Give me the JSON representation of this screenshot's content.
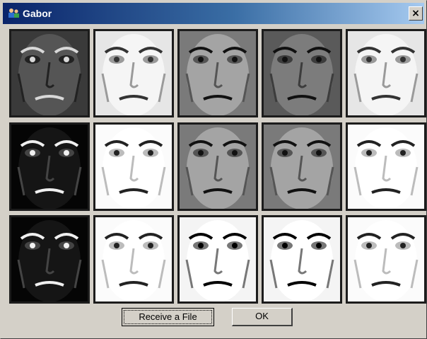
{
  "window": {
    "title": "Gabor",
    "close_glyph": "×",
    "app_icon": "people-app-icon"
  },
  "grid": {
    "rows": 3,
    "columns": 5,
    "tiles": [
      {
        "row": 1,
        "col": 1,
        "tone": "dark"
      },
      {
        "row": 1,
        "col": 2,
        "tone": "light"
      },
      {
        "row": 1,
        "col": 3,
        "tone": "mid"
      },
      {
        "row": 1,
        "col": 4,
        "tone": "mid-dark"
      },
      {
        "row": 1,
        "col": 5,
        "tone": "light"
      },
      {
        "row": 2,
        "col": 1,
        "tone": "black"
      },
      {
        "row": 2,
        "col": 2,
        "tone": "white"
      },
      {
        "row": 2,
        "col": 3,
        "tone": "mid"
      },
      {
        "row": 2,
        "col": 4,
        "tone": "mid"
      },
      {
        "row": 2,
        "col": 5,
        "tone": "white"
      },
      {
        "row": 3,
        "col": 1,
        "tone": "black"
      },
      {
        "row": 3,
        "col": 2,
        "tone": "white"
      },
      {
        "row": 3,
        "col": 3,
        "tone": "white-strong"
      },
      {
        "row": 3,
        "col": 4,
        "tone": "white-strong"
      },
      {
        "row": 3,
        "col": 5,
        "tone": "white"
      }
    ]
  },
  "buttons": {
    "receive_label": "Receive a File",
    "ok_label": "OK"
  }
}
